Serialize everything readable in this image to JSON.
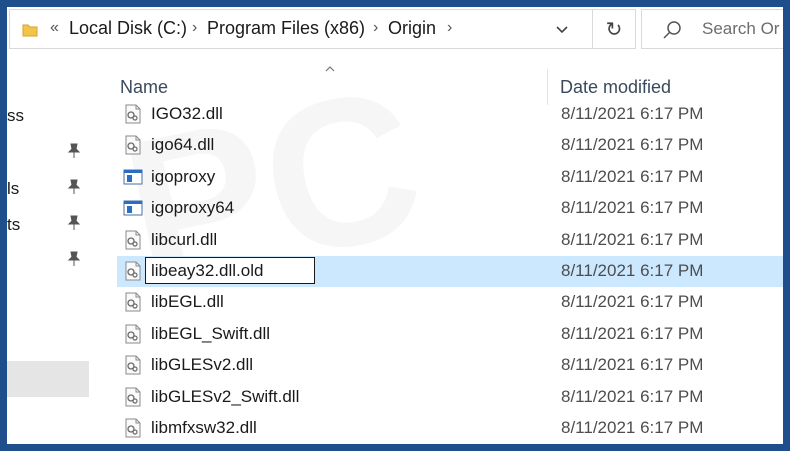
{
  "address_bar": {
    "breadcrumbs": [
      "Local Disk (C:)",
      "Program Files (x86)",
      "Origin"
    ],
    "overflow_chevron": "«",
    "separator": "›",
    "dropdown": "⌄"
  },
  "refresh": {
    "glyph": "↻"
  },
  "search": {
    "placeholder": "Search Or"
  },
  "nav": {
    "items": [
      {
        "label": "ss"
      },
      {
        "label": "ls"
      },
      {
        "label": "ts"
      }
    ]
  },
  "columns": {
    "name": "Name",
    "date_modified": "Date modified"
  },
  "files": [
    {
      "name": "IGO32.dll",
      "date": "8/11/2021 6:17 PM",
      "icon": "dll-file-icon"
    },
    {
      "name": "igo64.dll",
      "date": "8/11/2021 6:17 PM",
      "icon": "dll-file-icon"
    },
    {
      "name": "igoproxy",
      "date": "8/11/2021 6:17 PM",
      "icon": "application-icon"
    },
    {
      "name": "igoproxy64",
      "date": "8/11/2021 6:17 PM",
      "icon": "application-icon"
    },
    {
      "name": "libcurl.dll",
      "date": "8/11/2021 6:17 PM",
      "icon": "dll-file-icon"
    },
    {
      "name": "libeay32.dll.old",
      "date": "8/11/2021 6:17 PM",
      "icon": "dll-file-icon",
      "renaming": true
    },
    {
      "name": "libEGL.dll",
      "date": "8/11/2021 6:17 PM",
      "icon": "dll-file-icon"
    },
    {
      "name": "libEGL_Swift.dll",
      "date": "8/11/2021 6:17 PM",
      "icon": "dll-file-icon"
    },
    {
      "name": "libGLESv2.dll",
      "date": "8/11/2021 6:17 PM",
      "icon": "dll-file-icon"
    },
    {
      "name": "libGLESv2_Swift.dll",
      "date": "8/11/2021 6:17 PM",
      "icon": "dll-file-icon"
    },
    {
      "name": "libmfxsw32.dll",
      "date": "8/11/2021 6:17 PM",
      "icon": "dll-file-icon"
    }
  ],
  "colors": {
    "selection": "#cce8ff",
    "frame": "#1f4e8c"
  }
}
